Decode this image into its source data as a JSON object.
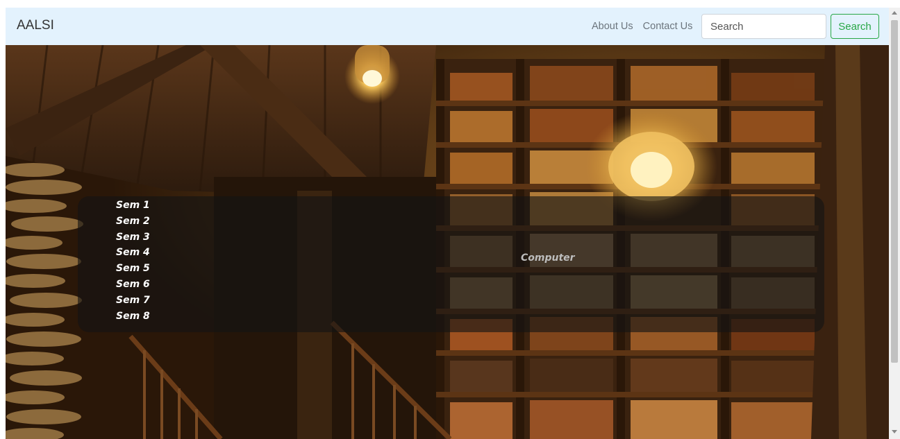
{
  "navbar": {
    "brand": "AALSI",
    "links": [
      "About Us",
      "Contact Us"
    ],
    "search_placeholder": "Search",
    "search_button": "Search",
    "accent_color": "#28a745",
    "background_color": "#e3f2fd"
  },
  "hero": {
    "background_icon": "library-bookshelves-image"
  },
  "panel": {
    "items": [
      "Sem 1",
      "Sem 2",
      "Sem 3",
      "Sem 4",
      "Sem 5",
      "Sem 6",
      "Sem 7",
      "Sem 8"
    ],
    "title": "Computer"
  }
}
